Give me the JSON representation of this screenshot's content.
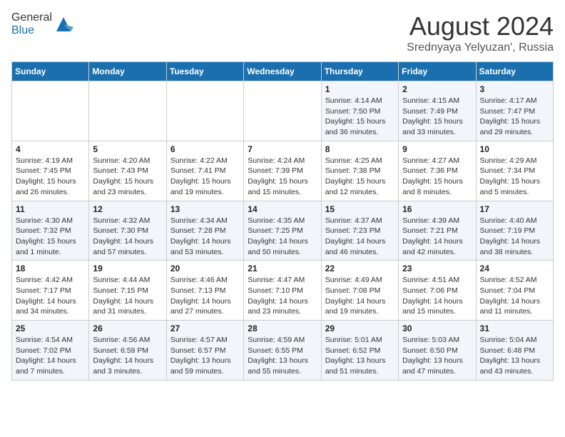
{
  "header": {
    "logo_general": "General",
    "logo_blue": "Blue",
    "month_year": "August 2024",
    "location": "Srednyaya Yelyuzan', Russia"
  },
  "days_of_week": [
    "Sunday",
    "Monday",
    "Tuesday",
    "Wednesday",
    "Thursday",
    "Friday",
    "Saturday"
  ],
  "weeks": [
    [
      {
        "day": "",
        "info": ""
      },
      {
        "day": "",
        "info": ""
      },
      {
        "day": "",
        "info": ""
      },
      {
        "day": "",
        "info": ""
      },
      {
        "day": "1",
        "info": "Sunrise: 4:14 AM\nSunset: 7:50 PM\nDaylight: 15 hours\nand 36 minutes."
      },
      {
        "day": "2",
        "info": "Sunrise: 4:15 AM\nSunset: 7:49 PM\nDaylight: 15 hours\nand 33 minutes."
      },
      {
        "day": "3",
        "info": "Sunrise: 4:17 AM\nSunset: 7:47 PM\nDaylight: 15 hours\nand 29 minutes."
      }
    ],
    [
      {
        "day": "4",
        "info": "Sunrise: 4:19 AM\nSunset: 7:45 PM\nDaylight: 15 hours\nand 26 minutes."
      },
      {
        "day": "5",
        "info": "Sunrise: 4:20 AM\nSunset: 7:43 PM\nDaylight: 15 hours\nand 23 minutes."
      },
      {
        "day": "6",
        "info": "Sunrise: 4:22 AM\nSunset: 7:41 PM\nDaylight: 15 hours\nand 19 minutes."
      },
      {
        "day": "7",
        "info": "Sunrise: 4:24 AM\nSunset: 7:39 PM\nDaylight: 15 hours\nand 15 minutes."
      },
      {
        "day": "8",
        "info": "Sunrise: 4:25 AM\nSunset: 7:38 PM\nDaylight: 15 hours\nand 12 minutes."
      },
      {
        "day": "9",
        "info": "Sunrise: 4:27 AM\nSunset: 7:36 PM\nDaylight: 15 hours\nand 8 minutes."
      },
      {
        "day": "10",
        "info": "Sunrise: 4:29 AM\nSunset: 7:34 PM\nDaylight: 15 hours\nand 5 minutes."
      }
    ],
    [
      {
        "day": "11",
        "info": "Sunrise: 4:30 AM\nSunset: 7:32 PM\nDaylight: 15 hours\nand 1 minute."
      },
      {
        "day": "12",
        "info": "Sunrise: 4:32 AM\nSunset: 7:30 PM\nDaylight: 14 hours\nand 57 minutes."
      },
      {
        "day": "13",
        "info": "Sunrise: 4:34 AM\nSunset: 7:28 PM\nDaylight: 14 hours\nand 53 minutes."
      },
      {
        "day": "14",
        "info": "Sunrise: 4:35 AM\nSunset: 7:25 PM\nDaylight: 14 hours\nand 50 minutes."
      },
      {
        "day": "15",
        "info": "Sunrise: 4:37 AM\nSunset: 7:23 PM\nDaylight: 14 hours\nand 46 minutes."
      },
      {
        "day": "16",
        "info": "Sunrise: 4:39 AM\nSunset: 7:21 PM\nDaylight: 14 hours\nand 42 minutes."
      },
      {
        "day": "17",
        "info": "Sunrise: 4:40 AM\nSunset: 7:19 PM\nDaylight: 14 hours\nand 38 minutes."
      }
    ],
    [
      {
        "day": "18",
        "info": "Sunrise: 4:42 AM\nSunset: 7:17 PM\nDaylight: 14 hours\nand 34 minutes."
      },
      {
        "day": "19",
        "info": "Sunrise: 4:44 AM\nSunset: 7:15 PM\nDaylight: 14 hours\nand 31 minutes."
      },
      {
        "day": "20",
        "info": "Sunrise: 4:46 AM\nSunset: 7:13 PM\nDaylight: 14 hours\nand 27 minutes."
      },
      {
        "day": "21",
        "info": "Sunrise: 4:47 AM\nSunset: 7:10 PM\nDaylight: 14 hours\nand 23 minutes."
      },
      {
        "day": "22",
        "info": "Sunrise: 4:49 AM\nSunset: 7:08 PM\nDaylight: 14 hours\nand 19 minutes."
      },
      {
        "day": "23",
        "info": "Sunrise: 4:51 AM\nSunset: 7:06 PM\nDaylight: 14 hours\nand 15 minutes."
      },
      {
        "day": "24",
        "info": "Sunrise: 4:52 AM\nSunset: 7:04 PM\nDaylight: 14 hours\nand 11 minutes."
      }
    ],
    [
      {
        "day": "25",
        "info": "Sunrise: 4:54 AM\nSunset: 7:02 PM\nDaylight: 14 hours\nand 7 minutes."
      },
      {
        "day": "26",
        "info": "Sunrise: 4:56 AM\nSunset: 6:59 PM\nDaylight: 14 hours\nand 3 minutes."
      },
      {
        "day": "27",
        "info": "Sunrise: 4:57 AM\nSunset: 6:57 PM\nDaylight: 13 hours\nand 59 minutes."
      },
      {
        "day": "28",
        "info": "Sunrise: 4:59 AM\nSunset: 6:55 PM\nDaylight: 13 hours\nand 55 minutes."
      },
      {
        "day": "29",
        "info": "Sunrise: 5:01 AM\nSunset: 6:52 PM\nDaylight: 13 hours\nand 51 minutes."
      },
      {
        "day": "30",
        "info": "Sunrise: 5:03 AM\nSunset: 6:50 PM\nDaylight: 13 hours\nand 47 minutes."
      },
      {
        "day": "31",
        "info": "Sunrise: 5:04 AM\nSunset: 6:48 PM\nDaylight: 13 hours\nand 43 minutes."
      }
    ]
  ]
}
